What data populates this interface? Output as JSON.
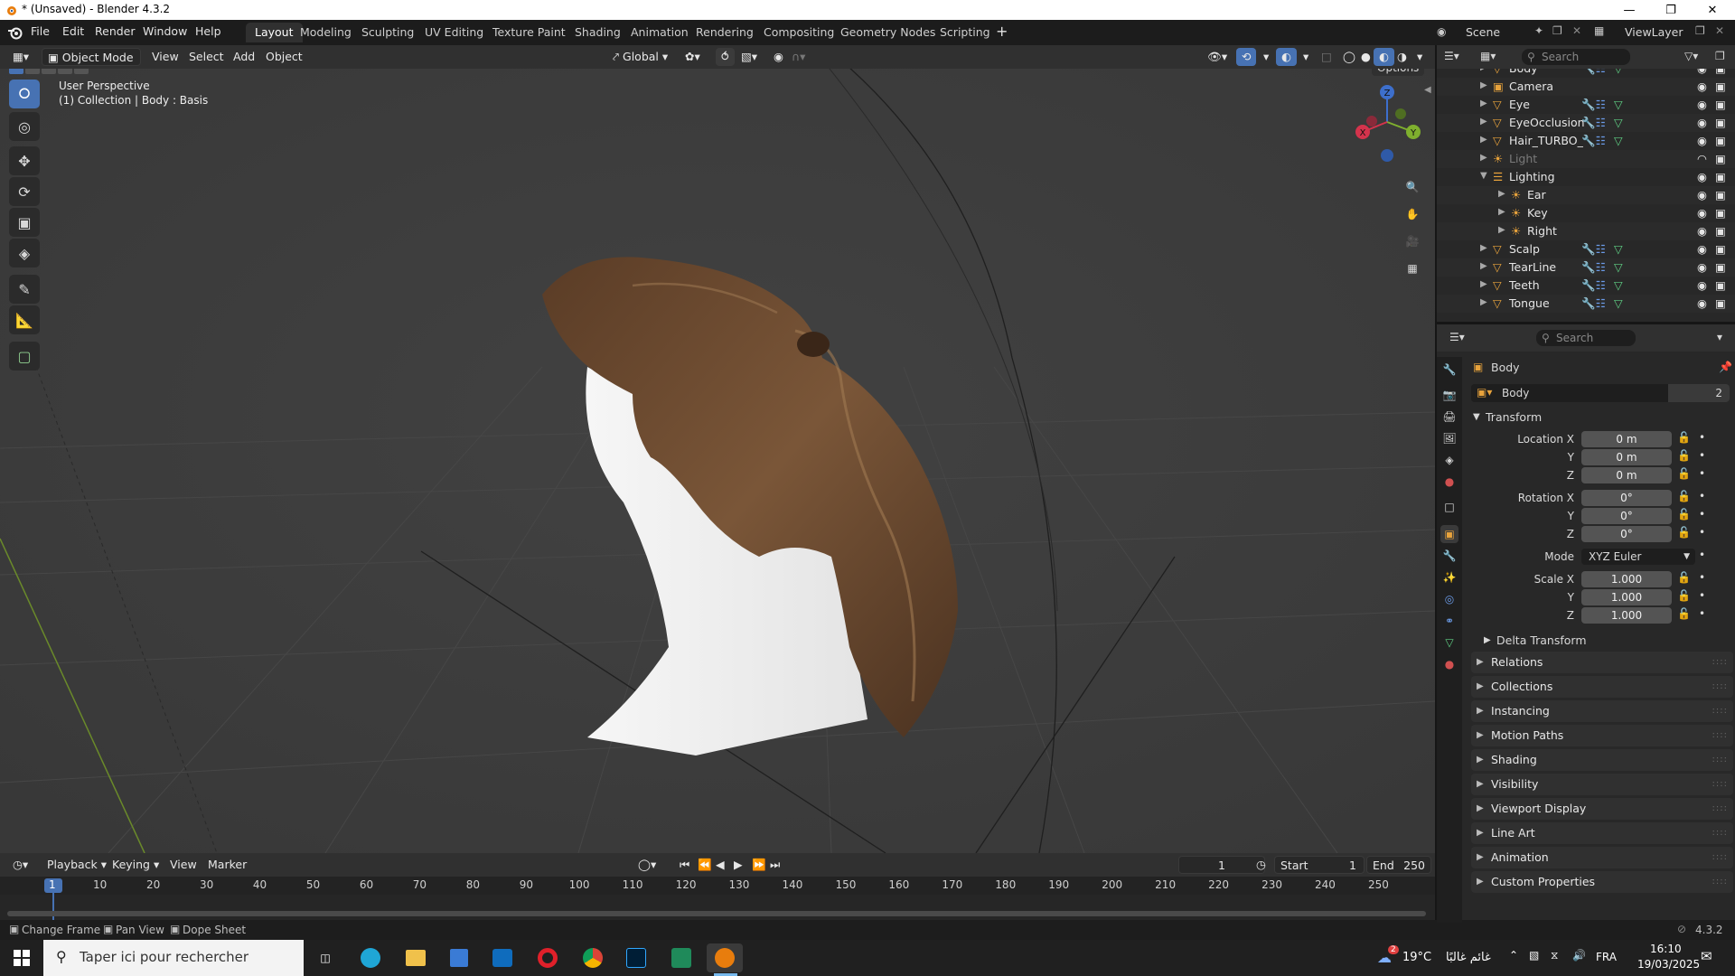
{
  "window": {
    "title": "* (Unsaved) - Blender 4.3.2"
  },
  "menu": {
    "items": [
      "File",
      "Edit",
      "Render",
      "Window",
      "Help"
    ]
  },
  "workspaces": {
    "tabs": [
      "Layout",
      "Modeling",
      "Sculpting",
      "UV Editing",
      "Texture Paint",
      "Shading",
      "Animation",
      "Rendering",
      "Compositing",
      "Geometry Nodes",
      "Scripting"
    ],
    "active": "Layout"
  },
  "topright": {
    "scene": "Scene",
    "viewlayer": "ViewLayer"
  },
  "viewport_header": {
    "mode": "Object Mode",
    "menus": [
      "View",
      "Select",
      "Add",
      "Object"
    ],
    "orientation": "Global",
    "options": "Options"
  },
  "viewport": {
    "perspective": "User Perspective",
    "context": "(1) Collection | Body : Basis",
    "gizmo": {
      "x": "X",
      "y": "Y",
      "z": "Z"
    }
  },
  "outliner": {
    "search_placeholder": "Search",
    "rows": [
      {
        "name": "Body",
        "dim": false
      },
      {
        "name": "Camera",
        "dim": false
      },
      {
        "name": "Eye",
        "dim": false
      },
      {
        "name": "EyeOcclusion",
        "dim": false
      },
      {
        "name": "Hair_TURBO_",
        "dim": false
      },
      {
        "name": "Light",
        "dim": true
      },
      {
        "name": "Lighting",
        "dim": false
      },
      {
        "name": "Ear",
        "dim": false
      },
      {
        "name": "Key",
        "dim": false
      },
      {
        "name": "Right",
        "dim": false
      },
      {
        "name": "Scalp",
        "dim": false
      },
      {
        "name": "TearLine",
        "dim": false
      },
      {
        "name": "Teeth",
        "dim": false
      },
      {
        "name": "Tongue",
        "dim": false
      }
    ]
  },
  "properties": {
    "search_placeholder": "Search",
    "object_name": "Body",
    "datablock": "Body",
    "users": "2",
    "transform_label": "Transform",
    "location": {
      "label": "Location X",
      "x": "0 m",
      "y": "0 m",
      "z": "0 m"
    },
    "rotation": {
      "label": "Rotation X",
      "x": "0°",
      "y": "0°",
      "z": "0°"
    },
    "mode": {
      "label": "Mode",
      "value": "XYZ Euler"
    },
    "scale": {
      "label": "Scale X",
      "x": "1.000",
      "y": "1.000",
      "z": "1.000"
    },
    "y": "Y",
    "z": "Z",
    "delta": "Delta Transform",
    "panels": [
      "Relations",
      "Collections",
      "Instancing",
      "Motion Paths",
      "Shading",
      "Visibility",
      "Viewport Display",
      "Line Art",
      "Animation",
      "Custom Properties"
    ]
  },
  "timeline": {
    "menus": [
      "Playback",
      "Keying",
      "View",
      "Marker"
    ],
    "current_frame": "1",
    "start_label": "Start",
    "start": "1",
    "end_label": "End",
    "end": "250",
    "ticks": [
      "1",
      "10",
      "20",
      "30",
      "40",
      "50",
      "60",
      "70",
      "80",
      "90",
      "100",
      "110",
      "120",
      "130",
      "140",
      "150",
      "160",
      "170",
      "180",
      "190",
      "200",
      "210",
      "220",
      "230",
      "240",
      "250"
    ]
  },
  "statusbar": {
    "items": [
      "Change Frame",
      "Pan View",
      "Dope Sheet"
    ],
    "version": "4.3.2"
  },
  "taskbar": {
    "search_placeholder": "Taper ici pour rechercher",
    "weather": "19°C",
    "weather_text": "غائم غالبًا",
    "lang": "FRA",
    "time": "16:10",
    "date": "19/03/2025",
    "notif": "2"
  },
  "colors": {
    "accent": "#4772b3",
    "object_orange": "#e8a33c",
    "mesh_green": "#5fcf84",
    "modifier_blue": "#6b9be8"
  }
}
